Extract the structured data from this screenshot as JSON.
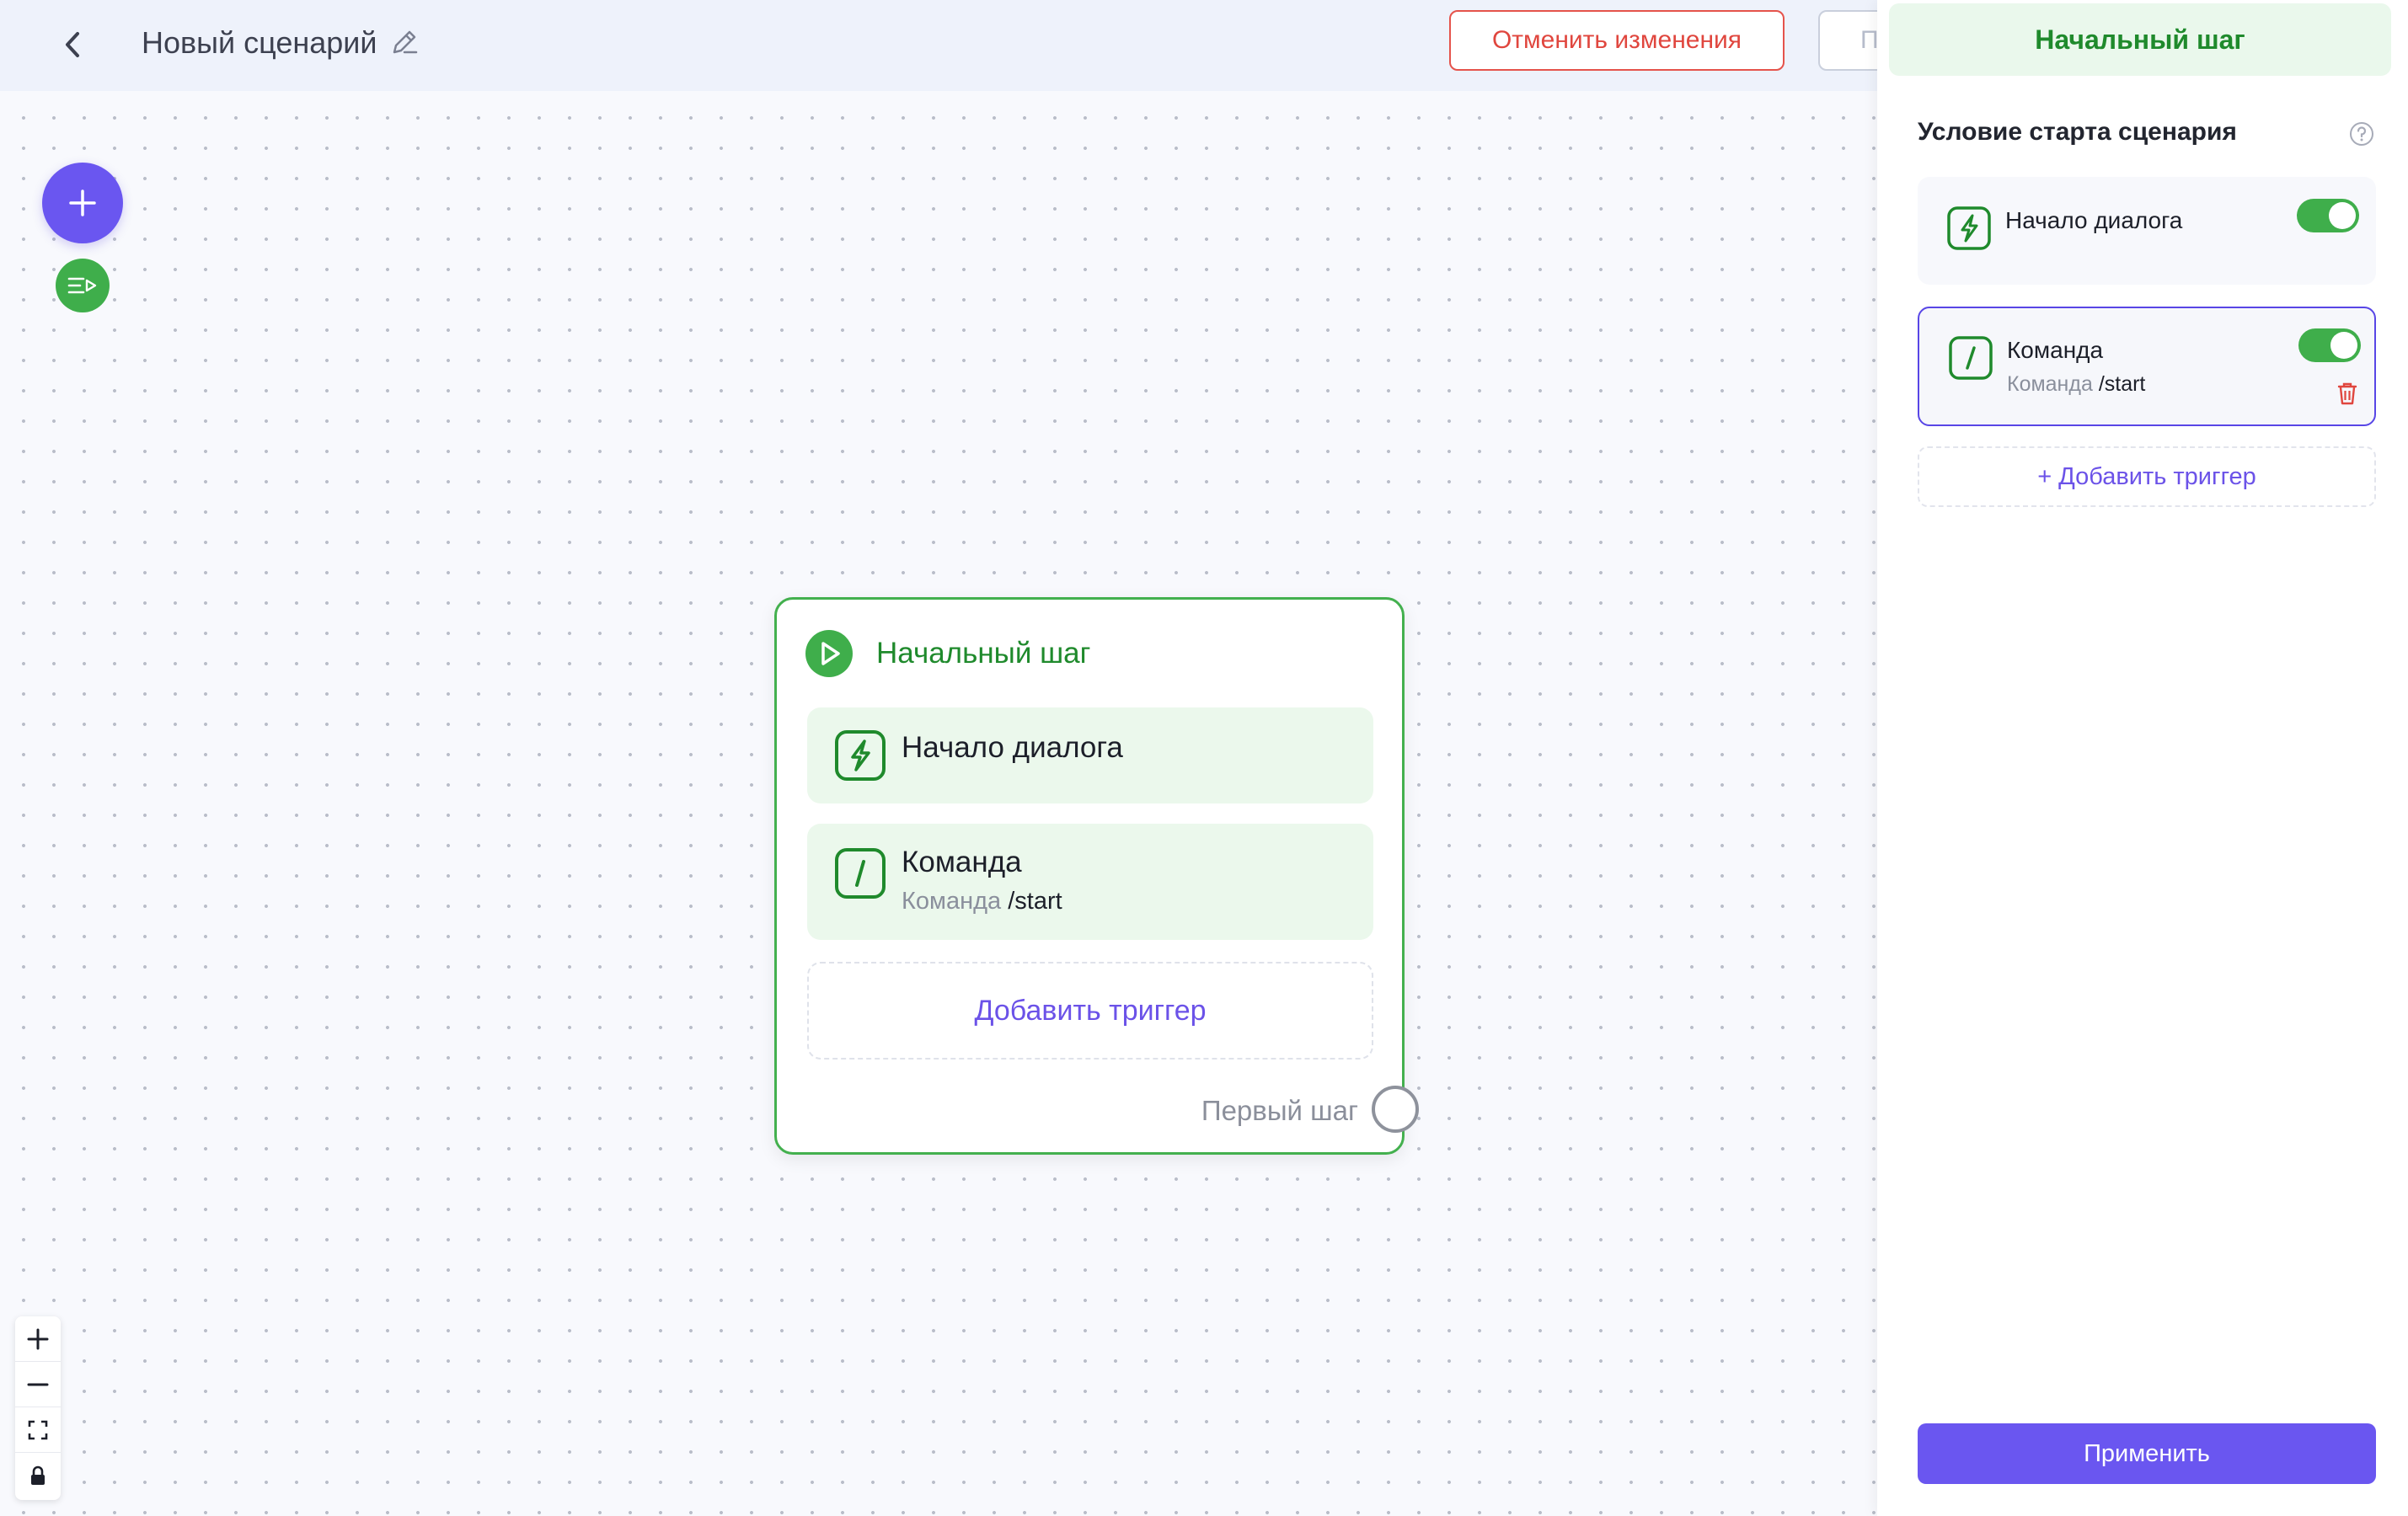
{
  "header": {
    "title": "Новый сценарий",
    "cancel_label": "Отменить изменения",
    "save_label": "П"
  },
  "node": {
    "title": "Начальный шаг",
    "triggers": [
      {
        "label": "Начало диалога",
        "icon": "lightning-icon"
      },
      {
        "label": "Команда",
        "sub_prefix": "Команда",
        "sub_value": "/start",
        "icon": "slash-icon"
      }
    ],
    "add_label": "Добавить триггер",
    "output_label": "Первый шаг"
  },
  "panel": {
    "title": "Начальный шаг",
    "section_title": "Условие старта сценария",
    "triggers": [
      {
        "label": "Начало диалога",
        "enabled": true,
        "icon": "lightning-icon"
      },
      {
        "label": "Команда",
        "sub_prefix": "Команда",
        "sub_value": "/start",
        "enabled": true,
        "icon": "slash-icon"
      }
    ],
    "add_label": "+ Добавить триггер",
    "apply_label": "Применить"
  },
  "colors": {
    "accent": "#6a56f0",
    "green": "#3fae4b",
    "danger": "#e0463e"
  }
}
